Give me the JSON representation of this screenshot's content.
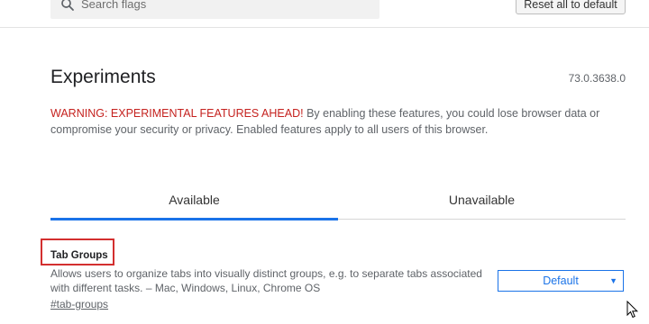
{
  "header": {
    "search_placeholder": "Search flags",
    "reset_label": "Reset all to default"
  },
  "main": {
    "title": "Experiments",
    "version": "73.0.3638.0",
    "warning_head": "WARNING: EXPERIMENTAL FEATURES AHEAD!",
    "warning_body": " By enabling these features, you could lose browser data or compromise your security or privacy. Enabled features apply to all users of this browser."
  },
  "tabs": [
    {
      "label": "Available",
      "selected": true
    },
    {
      "label": "Unavailable",
      "selected": false
    }
  ],
  "experiment": {
    "title": "Tab Groups",
    "description": "Allows users to organize tabs into visually distinct groups, e.g. to separate tabs associated with different tasks. – Mac, Windows, Linux, Chrome OS",
    "link": "#tab-groups",
    "select_value": "Default",
    "highlight_color": "#d32f2f"
  },
  "colors": {
    "accent": "#1a73e8",
    "warning": "#c5221f"
  },
  "icons": {
    "search": "search-icon",
    "dropdown": "chevron-down-icon",
    "cursor": "mouse-pointer-icon"
  }
}
